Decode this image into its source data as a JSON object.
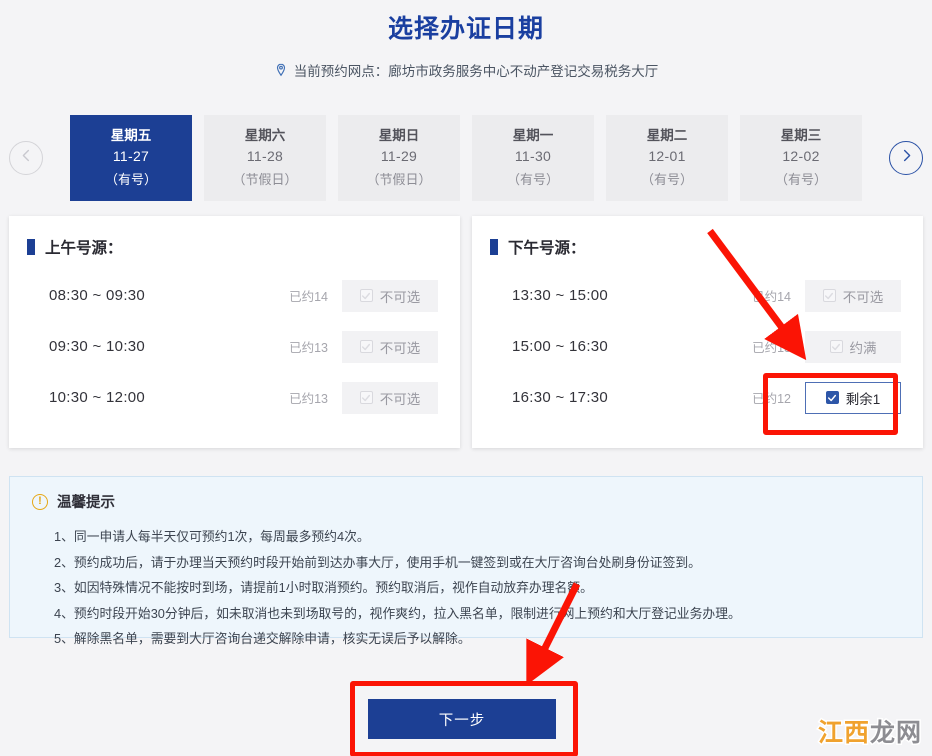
{
  "header": {
    "title": "选择办证日期",
    "site_label": "当前预约网点：廊坊市政务服务中心不动产登记交易税务大厅",
    "pin_icon": "location-pin-icon"
  },
  "date_strip": {
    "prev_icon": "chevron-left-icon",
    "next_icon": "chevron-right-icon",
    "prev_enabled": false,
    "next_enabled": true,
    "tabs": [
      {
        "dow": "星期五",
        "date": "11-27",
        "note": "（有号）",
        "selected": true
      },
      {
        "dow": "星期六",
        "date": "11-28",
        "note": "（节假日）",
        "selected": false
      },
      {
        "dow": "星期日",
        "date": "11-29",
        "note": "（节假日）",
        "selected": false
      },
      {
        "dow": "星期一",
        "date": "11-30",
        "note": "（有号）",
        "selected": false
      },
      {
        "dow": "星期二",
        "date": "12-01",
        "note": "（有号）",
        "selected": false
      },
      {
        "dow": "星期三",
        "date": "12-02",
        "note": "（有号）",
        "selected": false
      }
    ]
  },
  "morning": {
    "title": "上午号源：",
    "slots": [
      {
        "time": "08:30 ~ 09:30",
        "booked": "已约14",
        "state": "不可选",
        "checked": false,
        "enabled": false
      },
      {
        "time": "09:30 ~ 10:30",
        "booked": "已约13",
        "state": "不可选",
        "checked": false,
        "enabled": false
      },
      {
        "time": "10:30 ~ 12:00",
        "booked": "已约13",
        "state": "不可选",
        "checked": false,
        "enabled": false
      }
    ]
  },
  "afternoon": {
    "title": "下午号源：",
    "slots": [
      {
        "time": "13:30 ~ 15:00",
        "booked": "已约14",
        "state": "不可选",
        "checked": false,
        "enabled": false
      },
      {
        "time": "15:00 ~ 16:30",
        "booked": "已约13",
        "state": "约满",
        "checked": false,
        "enabled": false
      },
      {
        "time": "16:30 ~ 17:30",
        "booked": "已约12",
        "state": "剩余1",
        "checked": true,
        "enabled": true
      }
    ]
  },
  "tips": {
    "heading": "温馨提示",
    "warn_icon": "exclamation-circle-icon",
    "items": [
      "1、同一申请人每半天仅可预约1次，每周最多预约4次。",
      "2、预约成功后，请于办理当天预约时段开始前到达办事大厅，使用手机一键签到或在大厅咨询台处刷身份证签到。",
      "3、如因特殊情况不能按时到场，请提前1小时取消预约。预约取消后，视作自动放弃办理名额。",
      "4、预约时段开始30分钟后，如未取消也未到场取号的，视作爽约，拉入黑名单，限制进行网上预约和大厅登记业务办理。",
      "5、解除黑名单，需要到大厅咨询台递交解除申请，核实无误后予以解除。"
    ]
  },
  "footer": {
    "next_label": "下一步"
  },
  "watermark": {
    "part1": "江西",
    "part2": "龙网"
  },
  "colors": {
    "brand_blue": "#1c3f94",
    "title_blue": "#1a3fa0",
    "checkbox_blue": "#2d56a8",
    "annotation_red": "#fb1405",
    "tips_bg": "#eef6fc",
    "tips_border": "#cfe3f2",
    "disabled_gray": "#f2f2f4",
    "watermark_orange": "#f0a22e",
    "watermark_gray": "#8d8d92"
  }
}
